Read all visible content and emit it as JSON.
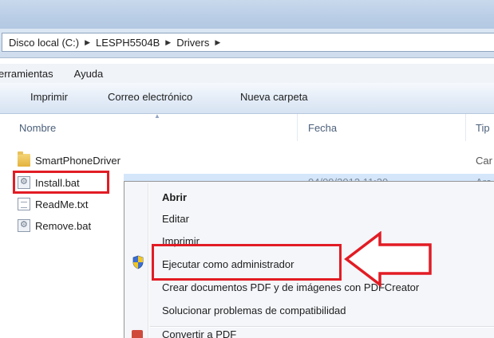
{
  "breadcrumb": {
    "items": [
      "Disco local (C:)",
      "LESPH5504B",
      "Drivers"
    ]
  },
  "menubar": {
    "items": [
      "erramientas",
      "Ayuda"
    ]
  },
  "toolbar": {
    "buttons": [
      "Imprimir",
      "Correo electrónico",
      "Nueva carpeta"
    ]
  },
  "columns": {
    "name": "Nombre",
    "date": "Fecha",
    "type": "Tip"
  },
  "files": [
    {
      "name": "SmartPhoneDriver",
      "icon": "folder-icon",
      "date": "",
      "type": "Car"
    },
    {
      "name": "Install.bat",
      "icon": "batch-file-icon",
      "date": "04/09/2012 11:20",
      "type": "Arc"
    },
    {
      "name": "ReadMe.txt",
      "icon": "text-file-icon",
      "date": "",
      "type": ""
    },
    {
      "name": "Remove.bat",
      "icon": "batch-file-icon",
      "date": "",
      "type": ""
    }
  ],
  "context_menu": {
    "items": [
      {
        "label": "Abrir",
        "bold": true
      },
      {
        "label": "Editar"
      },
      {
        "label": "Imprimir"
      },
      {
        "label": "Ejecutar como administrador",
        "icon": "uac-shield-icon"
      },
      {
        "label": "Crear documentos PDF y de imágenes con PDFCreator"
      },
      {
        "label": "Solucionar problemas de compatibilidad"
      },
      {
        "label": "Convertir a PDF",
        "icon": "pdf-icon"
      }
    ]
  },
  "colors": {
    "highlight_red": "#e21c24",
    "selection_blue": "#d5e6fb"
  }
}
